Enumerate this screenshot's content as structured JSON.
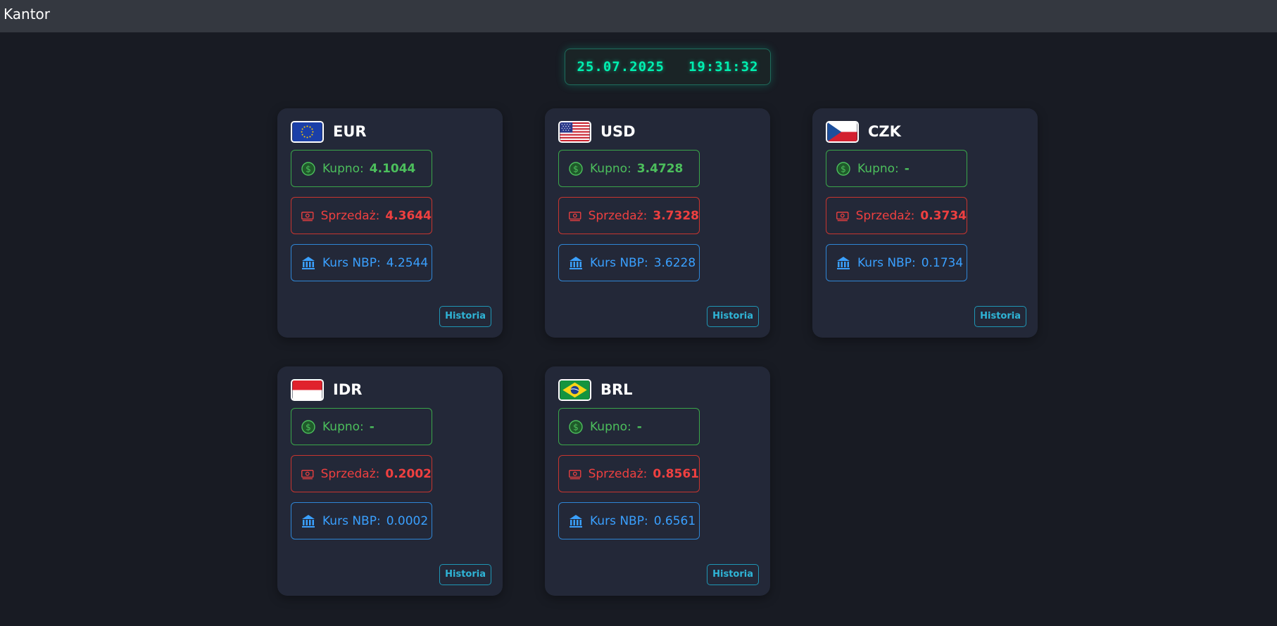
{
  "app": {
    "title": "Kantor"
  },
  "clock": {
    "date": "25.07.2025",
    "time": "19:31:32"
  },
  "labels": {
    "buy": "Kupno:",
    "sell": "Sprzedaż:",
    "nbp": "Kurs NBP:",
    "history": "Historia"
  },
  "colors": {
    "buy": "#4cbf5c",
    "sell": "#ef4040",
    "nbp": "#3aa0ff",
    "clock": "#00f0b0",
    "history": "#2fb4d6"
  },
  "currencies": [
    {
      "code": "EUR",
      "flag": "eu-flag-icon",
      "buy": "4.1044",
      "sell": "4.3644",
      "nbp": "4.2544"
    },
    {
      "code": "USD",
      "flag": "us-flag-icon",
      "buy": "3.4728",
      "sell": "3.7328",
      "nbp": "3.6228"
    },
    {
      "code": "CZK",
      "flag": "cz-flag-icon",
      "buy": "-",
      "sell": "0.3734",
      "nbp": "0.1734"
    },
    {
      "code": "IDR",
      "flag": "id-flag-icon",
      "buy": "-",
      "sell": "0.2002",
      "nbp": "0.0002"
    },
    {
      "code": "BRL",
      "flag": "br-flag-icon",
      "buy": "-",
      "sell": "0.8561",
      "nbp": "0.6561"
    }
  ],
  "icons": {
    "buy": "dollar-coin-icon",
    "sell": "cash-icon",
    "nbp": "bank-icon"
  }
}
